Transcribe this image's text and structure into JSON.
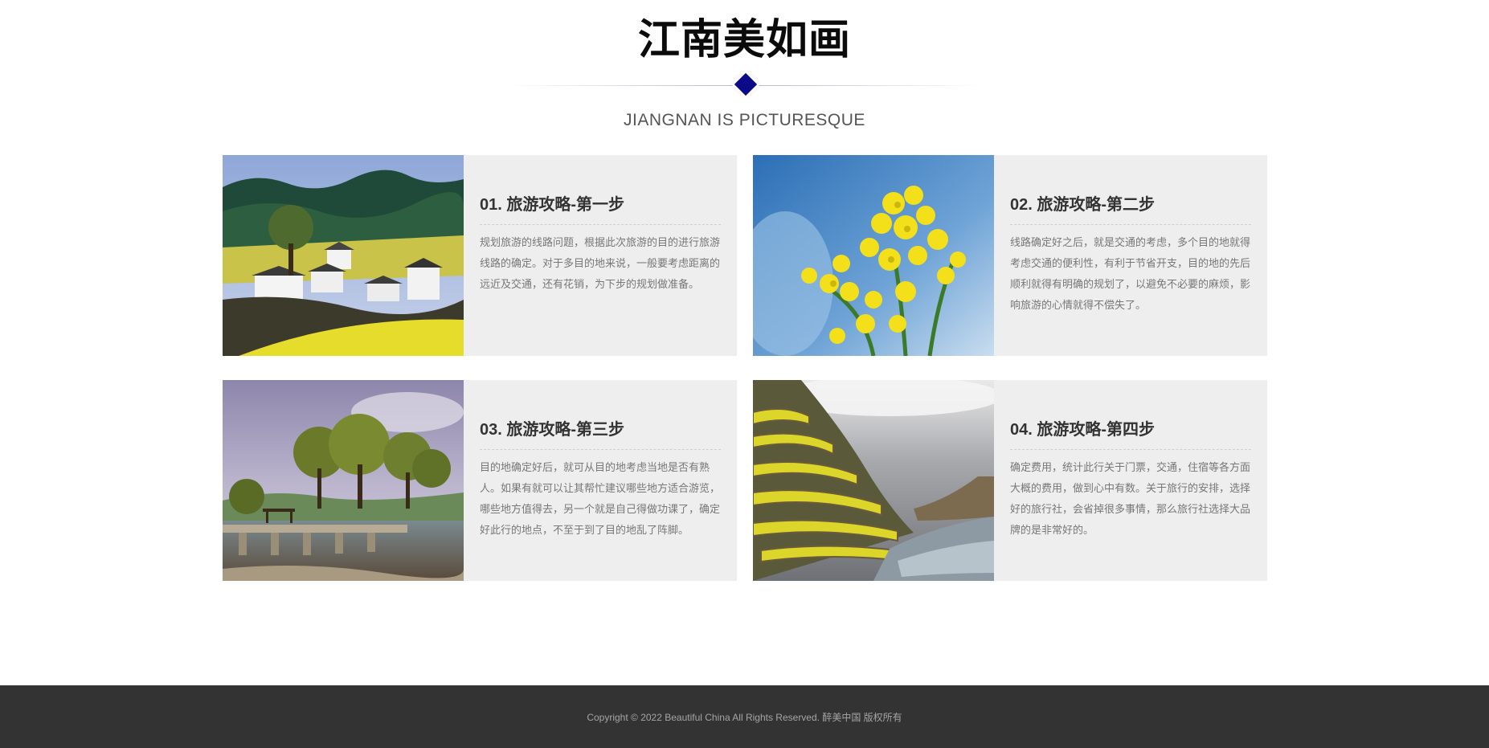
{
  "header": {
    "title": "江南美如画",
    "subtitle": "JIANGNAN IS PICTURESQUE"
  },
  "cards": [
    {
      "heading": "01. 旅游攻略-第一步",
      "text": "规划旅游的线路问题，根据此次旅游的目的进行旅游线路的确定。对于多目的地来说，一般要考虑距离的远近及交通，还有花销，为下步的规划做准备。",
      "image": "village-rapeseed-fields-photo"
    },
    {
      "heading": "02. 旅游攻略-第二步",
      "text": "线路确定好之后，就是交通的考虑，多个目的地就得考虑交通的便利性，有利于节省开支，目的地的先后顺利就得有明确的规划了，以避免不必要的麻烦，影响旅游的心情就得不偿失了。",
      "image": "rapeseed-flower-closeup-photo"
    },
    {
      "heading": "03. 旅游攻略-第三步",
      "text": "目的地确定好后，就可从目的地考虑当地是否有熟人。如果有就可以让其帮忙建议哪些地方适合游览，哪些地方值得去，另一个就是自己得做功课了，确定好此行的地点，不至于到了目的地乱了阵脚。",
      "image": "stone-bridge-trees-photo"
    },
    {
      "heading": "04. 旅游攻略-第四步",
      "text": "确定费用，统计此行关于门票，交通，住宿等各方面大概的费用，做到心中有数。关于旅行的安排，选择好的旅行社，会省掉很多事情，那么旅行社选择大品牌的是非常好的。",
      "image": "terraced-rapeseed-fields-photo"
    }
  ],
  "footer": {
    "copyright": "Copyright © 2022 Beautiful China All Rights Reserved. 醉美中国 版权所有"
  },
  "colors": {
    "accent": "#0b0b8a",
    "card_bg": "#eeeeee",
    "footer_bg": "#333333"
  }
}
